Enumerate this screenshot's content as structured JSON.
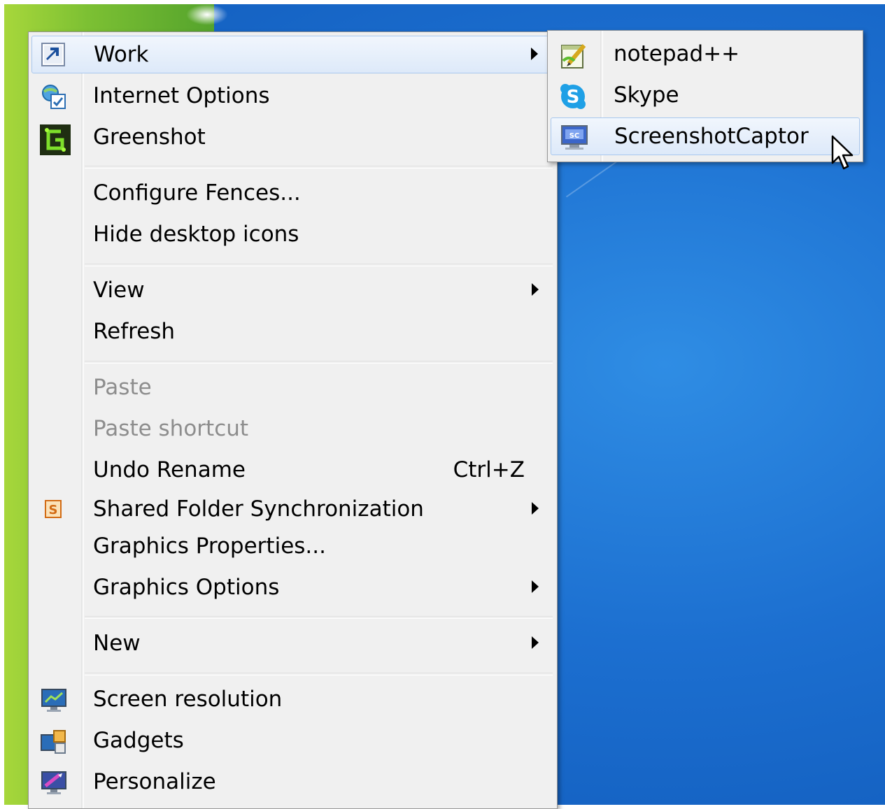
{
  "main_menu": {
    "items": [
      {
        "label": "Work",
        "icon": "work-shortcut-icon",
        "submenu": true,
        "highlighted": true
      },
      {
        "label": "Internet Options",
        "icon": "internet-options-icon"
      },
      {
        "label": "Greenshot",
        "icon": "greenshot-icon"
      },
      {
        "label": "Configure Fences..."
      },
      {
        "label": "Hide desktop icons"
      },
      {
        "label": "View",
        "submenu": true
      },
      {
        "label": "Refresh"
      },
      {
        "label": "Paste",
        "disabled": true
      },
      {
        "label": "Paste shortcut",
        "disabled": true
      },
      {
        "label": "Undo Rename",
        "shortcut": "Ctrl+Z"
      },
      {
        "label": "Shared Folder Synchronization",
        "icon": "shared-folder-sync-icon",
        "submenu": true
      },
      {
        "label": "Graphics Properties..."
      },
      {
        "label": "Graphics Options",
        "submenu": true
      },
      {
        "label": "New",
        "submenu": true
      },
      {
        "label": "Screen resolution",
        "icon": "screen-resolution-icon"
      },
      {
        "label": "Gadgets",
        "icon": "gadgets-icon"
      },
      {
        "label": "Personalize",
        "icon": "personalize-icon"
      }
    ]
  },
  "sub_menu": {
    "items": [
      {
        "label": "notepad++",
        "icon": "notepad-plus-plus-icon"
      },
      {
        "label": "Skype",
        "icon": "skype-icon"
      },
      {
        "label": "ScreenshotCaptor",
        "icon": "screenshotcaptor-icon",
        "highlighted": true
      }
    ]
  },
  "colors": {
    "menu_bg": "#f0f0f0",
    "highlight": "#dde9f9",
    "disabled_text": "#8d8d8d",
    "desktop_blue": "#1c6fd0",
    "desktop_green": "#7cc033"
  }
}
